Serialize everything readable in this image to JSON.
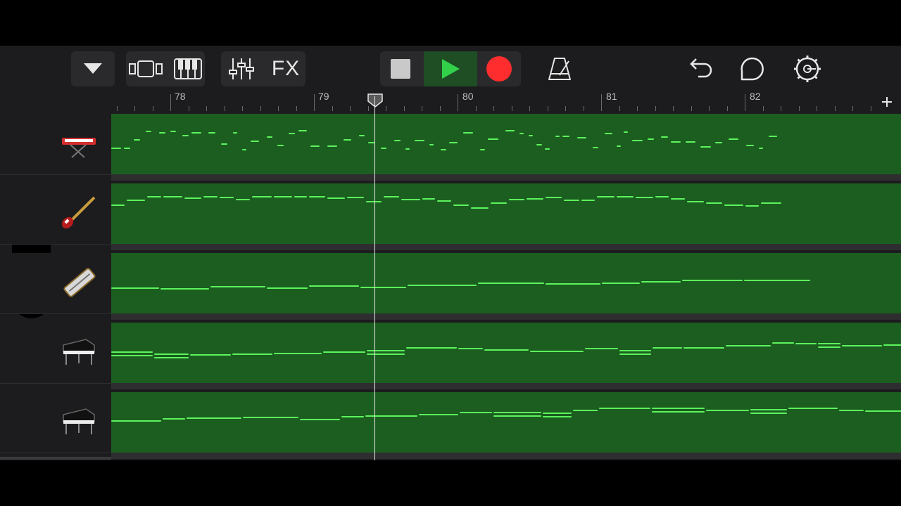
{
  "toolbar": {
    "fx_label": "FX",
    "colors": {
      "play": "#33d14a",
      "record": "#ff2d2d",
      "stop": "#c9c9c9",
      "play_bg": "#1f4d24"
    }
  },
  "ruler": {
    "bars": [
      "78",
      "79",
      "80",
      "81",
      "82"
    ]
  },
  "icons": {
    "menu": "triangle-down-icon",
    "tracks_view": "tracks-view-icon",
    "keyboard": "piano-keys-icon",
    "mixer": "mixer-sliders-icon",
    "stop": "stop-icon",
    "play": "play-icon",
    "record": "record-icon",
    "metronome": "metronome-icon",
    "undo": "undo-icon",
    "loop": "loop-icon",
    "settings": "gear-icon",
    "add": "plus-icon"
  },
  "tracks": [
    {
      "instrument": "keyboard-icon"
    },
    {
      "instrument": "bass-guitar-icon"
    },
    {
      "instrument": "harmonica-icon"
    },
    {
      "instrument": "grand-piano-icon"
    },
    {
      "instrument": "grand-piano-icon"
    }
  ],
  "colors": {
    "region": "#1b5e20",
    "note": "#5df45d",
    "background": "#1c1c1e"
  }
}
